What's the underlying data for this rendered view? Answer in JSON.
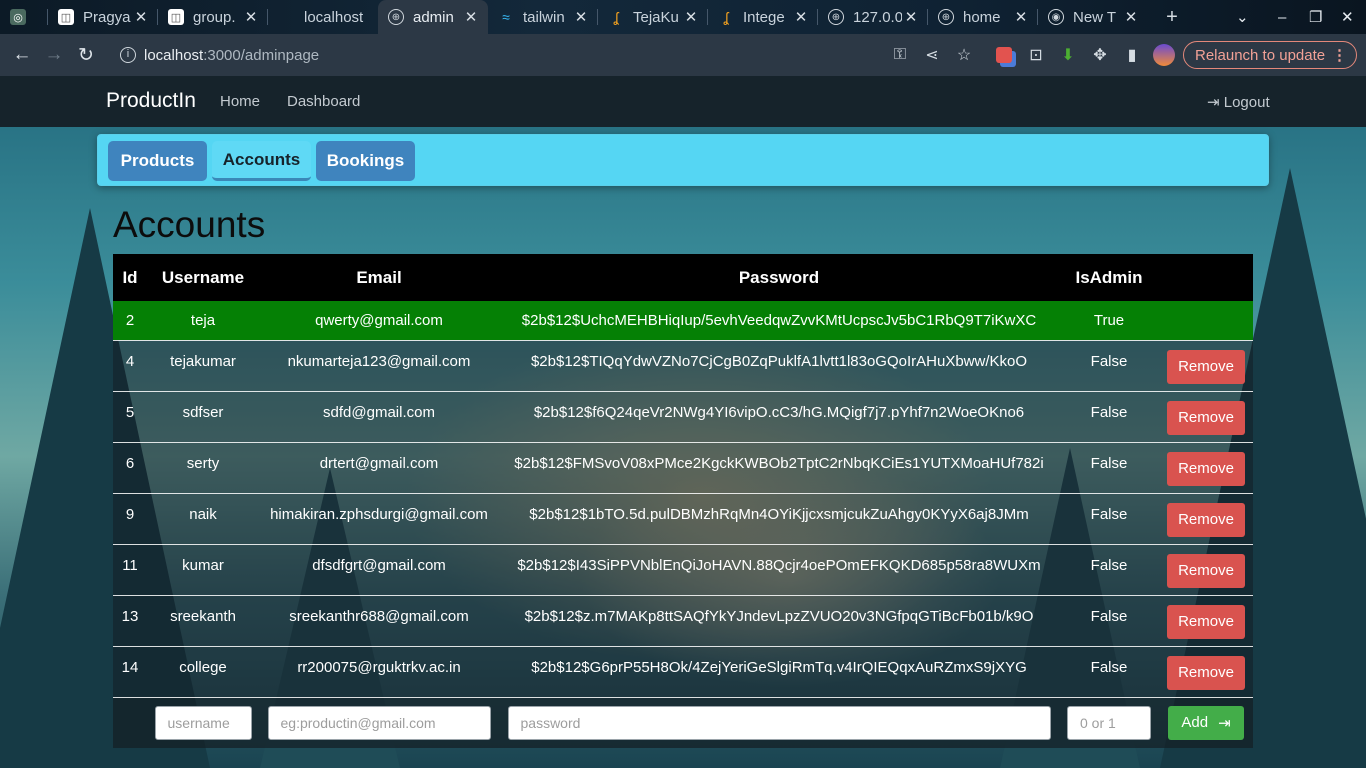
{
  "browser": {
    "tabs": [
      {
        "title": "",
        "icon": "chatgpt-icon"
      },
      {
        "title": "Pragya",
        "icon": "doc-icon"
      },
      {
        "title": "group.",
        "icon": "doc-icon"
      },
      {
        "title": "localhost",
        "icon": "blank-icon"
      },
      {
        "title": "admin",
        "icon": "globe-icon"
      },
      {
        "title": "tailwin",
        "icon": "tailwind-icon"
      },
      {
        "title": "TejaKu",
        "icon": "leetcode-icon"
      },
      {
        "title": "Intege",
        "icon": "leetcode-icon"
      },
      {
        "title": "127.0.0",
        "icon": "globe-icon"
      },
      {
        "title": "home",
        "icon": "globe-icon"
      },
      {
        "title": "New T",
        "icon": "chrome-icon"
      }
    ],
    "url_host": "localhost",
    "url_path": ":3000/adminpage",
    "relaunch_label": "Relaunch to update"
  },
  "navbar": {
    "brand": "ProductIn",
    "links": [
      "Home",
      "Dashboard"
    ],
    "logout": "Logout"
  },
  "section_tabs": [
    "Products",
    "Accounts",
    "Bookings"
  ],
  "active_tab": "Accounts",
  "heading": "Accounts",
  "table": {
    "headers": [
      "Id",
      "Username",
      "Email",
      "Password",
      "IsAdmin",
      ""
    ],
    "rows": [
      {
        "id": "2",
        "username": "teja",
        "email": "qwerty@gmail.com",
        "password": "$2b$12$UchcMEHBHiqIup/5evhVeedqwZvvKMtUcpscJv5bC1RbQ9T7iKwXC",
        "is_admin": "True",
        "action": ""
      },
      {
        "id": "4",
        "username": "tejakumar",
        "email": "nkumarteja123@gmail.com",
        "password": "$2b$12$TIQqYdwVZNo7CjCgB0ZqPuklfA1lvtt1l83oGQoIrAHuXbww/KkoO",
        "is_admin": "False",
        "action": "Remove"
      },
      {
        "id": "5",
        "username": "sdfser",
        "email": "sdfd@gmail.com",
        "password": "$2b$12$f6Q24qeVr2NWg4YI6vipO.cC3/hG.MQigf7j7.pYhf7n2WoeOKno6",
        "is_admin": "False",
        "action": "Remove"
      },
      {
        "id": "6",
        "username": "serty",
        "email": "drtert@gmail.com",
        "password": "$2b$12$FMSvoV08xPMce2KgckKWBOb2TptC2rNbqKCiEs1YUTXMoaHUf782i",
        "is_admin": "False",
        "action": "Remove"
      },
      {
        "id": "9",
        "username": "naik",
        "email": "himakiran.zphsdurgi@gmail.com",
        "password": "$2b$12$1bTO.5d.pulDBMzhRqMn4OYiKjjcxsmjcukZuAhgy0KYyX6aj8JMm",
        "is_admin": "False",
        "action": "Remove"
      },
      {
        "id": "11",
        "username": "kumar",
        "email": "dfsdfgrt@gmail.com",
        "password": "$2b$12$I43SiPPVNblEnQiJoHAVN.88Qcjr4oePOmEFKQKD685p58ra8WUXm",
        "is_admin": "False",
        "action": "Remove"
      },
      {
        "id": "13",
        "username": "sreekanth",
        "email": "sreekanthr688@gmail.com",
        "password": "$2b$12$z.m7MAKp8ttSAQfYkYJndevLpzZVUO20v3NGfpqGTiBcFb01b/k9O",
        "is_admin": "False",
        "action": "Remove"
      },
      {
        "id": "14",
        "username": "college",
        "email": "rr200075@rguktrkv.ac.in",
        "password": "$2b$12$G6prP55H8Ok/4ZejYeriGeSlgiRmTq.v4IrQIEQqxAuRZmxS9jXYG",
        "is_admin": "False",
        "action": "Remove"
      }
    ]
  },
  "add_form": {
    "username_placeholder": "username",
    "email_placeholder": "eg:productin@gmail.com",
    "password_placeholder": "password",
    "isadmin_placeholder": "0 or 1",
    "add_label": "Add"
  },
  "colors": {
    "admin_row": "#058005",
    "remove_button": "#d9534f",
    "add_button": "#43ad49",
    "tab_panel": "#55d6f3"
  }
}
